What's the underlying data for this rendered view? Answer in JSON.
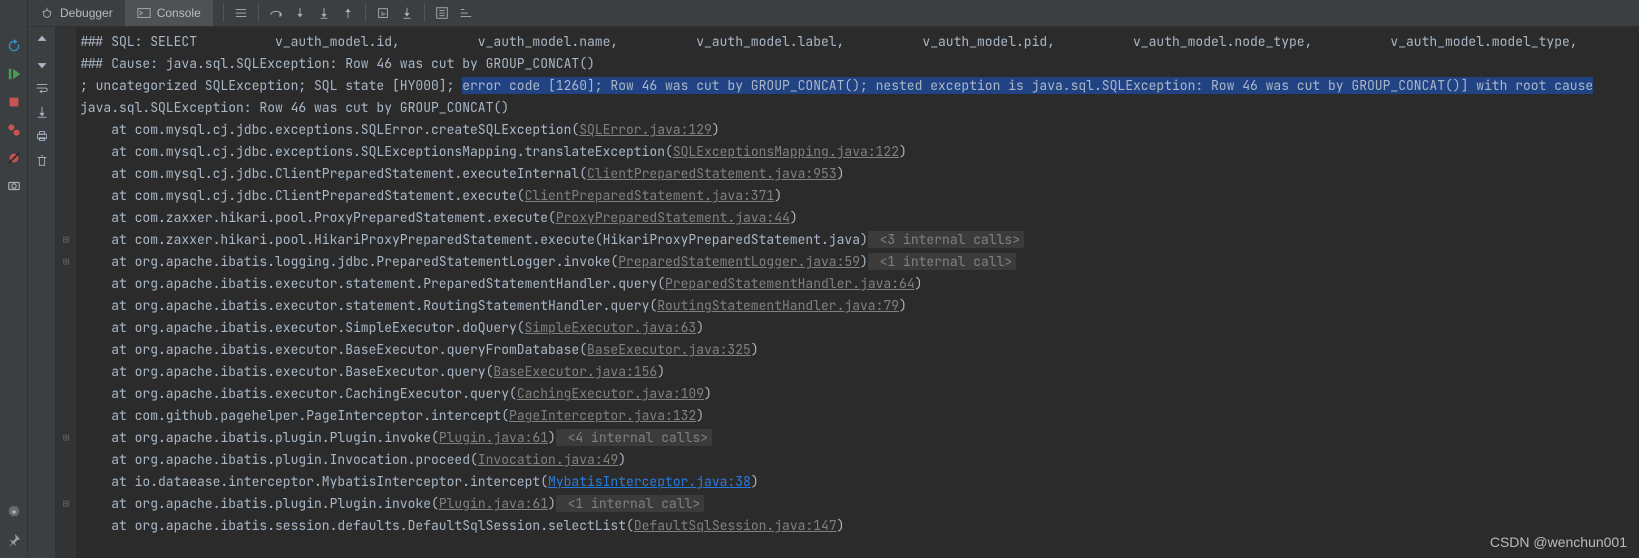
{
  "tabs": {
    "debugger": "Debugger",
    "console": "Console"
  },
  "leftRailTooltips": {
    "rerun": "Rerun",
    "resume": "Resume",
    "stop": "Stop",
    "breakpoints": "View Breakpoints",
    "mute": "Mute Breakpoints",
    "camera": "Get Thread Dump",
    "settings": "Settings",
    "pin": "Pin"
  },
  "topTools": {
    "up": "↑",
    "down": "↓",
    "softwrap": "Soft-Wrap",
    "scroll": "Scroll to End",
    "print": "Print",
    "clear": "Clear"
  },
  "lines": [
    {
      "pre": "### SQL: SELECT          v_auth_model.id,          v_auth_model.name,          v_auth_model.label,          v_auth_model.pid,          v_auth_model.node_type,          v_auth_model.model_type,          v"
    },
    {
      "pre": "### Cause: java.sql.SQLException: Row 46 was cut by GROUP_CONCAT()"
    },
    {
      "pre": "; uncategorized SQLException; SQL state [HY000]; ",
      "hl": "error code [1260]; Row 46 was cut by GROUP_CONCAT(); nested exception is java.sql.SQLException: Row 46 was cut by GROUP_CONCAT()] with root cause"
    },
    {
      "pre": "java.sql.SQLException: Row 46 was cut by GROUP_CONCAT()"
    },
    {
      "pre": "    at com.mysql.cj.jdbc.exceptions.SQLError.createSQLException(",
      "link": "SQLError.java:129",
      "post": ")"
    },
    {
      "pre": "    at com.mysql.cj.jdbc.exceptions.SQLExceptionsMapping.translateException(",
      "link": "SQLExceptionsMapping.java:122",
      "post": ")"
    },
    {
      "pre": "    at com.mysql.cj.jdbc.ClientPreparedStatement.executeInternal(",
      "link": "ClientPreparedStatement.java:953",
      "post": ")"
    },
    {
      "pre": "    at com.mysql.cj.jdbc.ClientPreparedStatement.execute(",
      "link": "ClientPreparedStatement.java:371",
      "post": ")"
    },
    {
      "pre": "    at com.zaxxer.hikari.pool.ProxyPreparedStatement.execute(",
      "link": "ProxyPreparedStatement.java:44",
      "post": ")"
    },
    {
      "pre": "    at com.zaxxer.hikari.pool.HikariProxyPreparedStatement.execute(HikariProxyPreparedStatement.java)",
      "badge": " <3 internal calls>",
      "fold": true
    },
    {
      "pre": "    at org.apache.ibatis.logging.jdbc.PreparedStatementLogger.invoke(",
      "link": "PreparedStatementLogger.java:59",
      "post": ")",
      "badge": " <1 internal call>",
      "fold": true
    },
    {
      "pre": "    at org.apache.ibatis.executor.statement.PreparedStatementHandler.query(",
      "link": "PreparedStatementHandler.java:64",
      "post": ")"
    },
    {
      "pre": "    at org.apache.ibatis.executor.statement.RoutingStatementHandler.query(",
      "link": "RoutingStatementHandler.java:79",
      "post": ")"
    },
    {
      "pre": "    at org.apache.ibatis.executor.SimpleExecutor.doQuery(",
      "link": "SimpleExecutor.java:63",
      "post": ")"
    },
    {
      "pre": "    at org.apache.ibatis.executor.BaseExecutor.queryFromDatabase(",
      "link": "BaseExecutor.java:325",
      "post": ")"
    },
    {
      "pre": "    at org.apache.ibatis.executor.BaseExecutor.query(",
      "link": "BaseExecutor.java:156",
      "post": ")"
    },
    {
      "pre": "    at org.apache.ibatis.executor.CachingExecutor.query(",
      "link": "CachingExecutor.java:109",
      "post": ")"
    },
    {
      "pre": "    at com.github.pagehelper.PageInterceptor.intercept(",
      "link": "PageInterceptor.java:132",
      "post": ")"
    },
    {
      "pre": "    at org.apache.ibatis.plugin.Plugin.invoke(",
      "link": "Plugin.java:61",
      "post": ")",
      "badge": " <4 internal calls>",
      "fold": true
    },
    {
      "pre": "    at org.apache.ibatis.plugin.Invocation.proceed(",
      "link": "Invocation.java:49",
      "post": ")"
    },
    {
      "pre": "    at io.dataease.interceptor.MybatisInterceptor.intercept(",
      "linkBlue": "MybatisInterceptor.java:38",
      "post": ")"
    },
    {
      "pre": "    at org.apache.ibatis.plugin.Plugin.invoke(",
      "link": "Plugin.java:61",
      "post": ")",
      "badge": " <1 internal call>",
      "fold": true
    },
    {
      "pre": "    at org.apache.ibatis.session.defaults.DefaultSqlSession.selectList(",
      "link": "DefaultSqlSession.java:147",
      "post": ")"
    }
  ],
  "watermark": "CSDN @wenchun001"
}
